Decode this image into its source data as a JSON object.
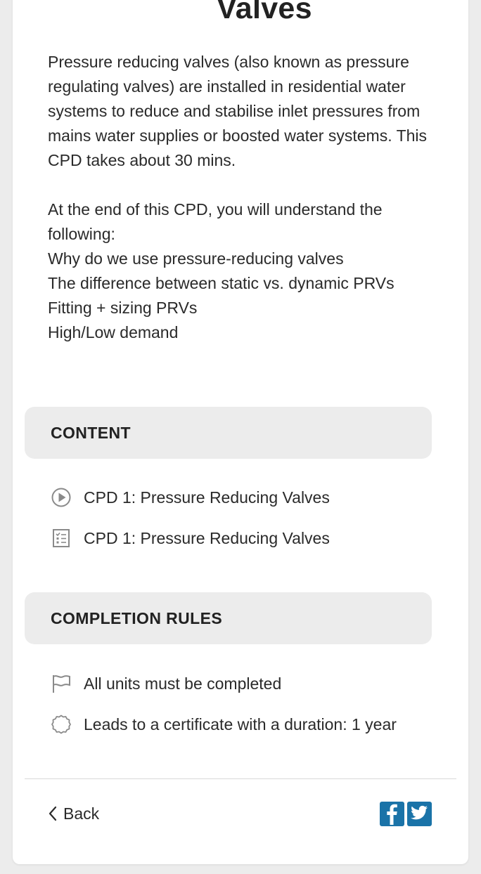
{
  "page": {
    "title": "Valves"
  },
  "description": {
    "paragraph1": "Pressure reducing valves (also known as pressure regulating valves) are installed in residential water systems to reduce and stabilise inlet pressures from mains water supplies or boosted water systems. This CPD takes about 30 mins.",
    "intro": "At the end of this CPD, you will understand the following:",
    "outcomes": [
      "Why do we use pressure-reducing valves",
      "The difference between static vs. dynamic PRVs",
      "Fitting + sizing PRVs",
      "High/Low demand"
    ]
  },
  "content": {
    "heading": "CONTENT",
    "items": [
      {
        "icon": "play-circle-icon",
        "label": "CPD 1: Pressure Reducing Valves"
      },
      {
        "icon": "checklist-icon",
        "label": "CPD 1: Pressure Reducing Valves"
      }
    ]
  },
  "completion_rules": {
    "heading": "COMPLETION RULES",
    "items": [
      {
        "icon": "flag-icon",
        "label": "All units must be completed"
      },
      {
        "icon": "certificate-badge-icon",
        "label": "Leads to a certificate with a duration: 1 year"
      }
    ]
  },
  "footer": {
    "back_label": "Back",
    "social": [
      {
        "icon": "facebook-icon",
        "color": "#1a73a8"
      },
      {
        "icon": "twitter-icon",
        "color": "#1a73a8"
      }
    ]
  },
  "colors": {
    "section_bg": "#ececec",
    "icon_gray": "#8a8a8a",
    "social_blue": "#1a73a8"
  }
}
